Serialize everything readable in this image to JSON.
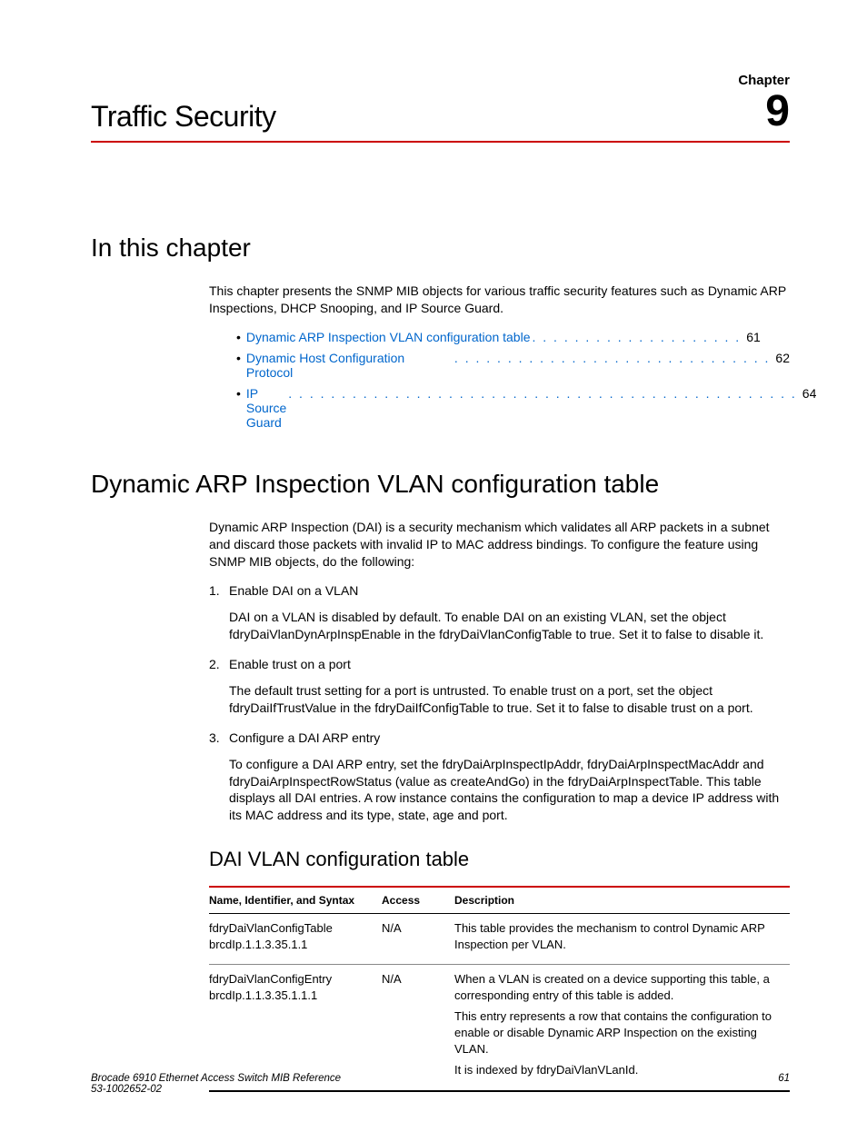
{
  "chapter": {
    "label": "Chapter",
    "number": "9",
    "title": "Traffic Security"
  },
  "section1": {
    "heading": "In this chapter",
    "intro": "This chapter presents the SNMP MIB objects for various traffic security features such as Dynamic ARP Inspections, DHCP Snooping, and IP Source Guard.",
    "toc": [
      {
        "label": "Dynamic ARP Inspection VLAN configuration table",
        "dots": ". . . . . . . . . . . . . . . . . . . .",
        "page": "61"
      },
      {
        "label": "Dynamic Host Configuration Protocol",
        "dots": " . . . . . . . . . . . . . . . . . . . . . . . . . . . . . .",
        "page": "62"
      },
      {
        "label": "IP Source Guard",
        "dots": ". . . . . . . . . . . . . . . . . . . . . . . . . . . . . . . . . . . . . . . . . . . . . . . .",
        "page": "64"
      }
    ]
  },
  "section2": {
    "heading": "Dynamic ARP Inspection VLAN configuration table",
    "intro": "Dynamic ARP Inspection (DAI) is a security mechanism which validates all ARP packets in a subnet and discard those packets with invalid IP to MAC address bindings. To configure the feature using SNMP MIB objects, do the following:",
    "steps": [
      {
        "num": "1.",
        "title": "Enable DAI on a VLAN",
        "body": "DAI on a VLAN is disabled by default. To enable DAI on an existing VLAN, set the object fdryDaiVlanDynArpInspEnable in the fdryDaiVlanConfigTable to true. Set it to false to disable it."
      },
      {
        "num": "2.",
        "title": "Enable trust on a port",
        "body": "The default trust setting for a port is untrusted. To enable trust on a port, set the object fdryDaiIfTrustValue in the fdryDaiIfConfigTable to true. Set it to false to disable trust on a port."
      },
      {
        "num": "3.",
        "title": "Configure a DAI ARP entry",
        "body": "To configure a DAI ARP entry, set the fdryDaiArpInspectIpAddr, fdryDaiArpInspectMacAddr and fdryDaiArpInspectRowStatus (value as createAndGo) in the fdryDaiArpInspectTable. This table displays all DAI entries. A row instance contains the configuration to map a device IP address with its MAC address and its type, state, age and port."
      }
    ]
  },
  "section3": {
    "heading": "DAI VLAN configuration table",
    "columns": [
      "Name, Identifier, and Syntax",
      "Access",
      "Description"
    ],
    "rows": [
      {
        "name_line1": "fdryDaiVlanConfigTable",
        "name_line2": "brcdIp.1.1.3.35.1.1",
        "access": "N/A",
        "desc": [
          "This table provides the mechanism to control Dynamic ARP Inspection per VLAN."
        ]
      },
      {
        "name_line1": "fdryDaiVlanConfigEntry",
        "name_line2": "brcdIp.1.1.3.35.1.1.1",
        "access": "N/A",
        "desc": [
          "When a VLAN is created on a device supporting this table, a corresponding entry of this table is added.",
          "This entry represents a row that contains the configuration to enable or disable Dynamic ARP Inspection on the existing VLAN.",
          "It is indexed by fdryDaiVlanVLanId."
        ]
      }
    ]
  },
  "footer": {
    "left_line1": "Brocade 6910 Ethernet Access Switch MIB Reference",
    "left_line2": "53-1002652-02",
    "right": "61"
  }
}
